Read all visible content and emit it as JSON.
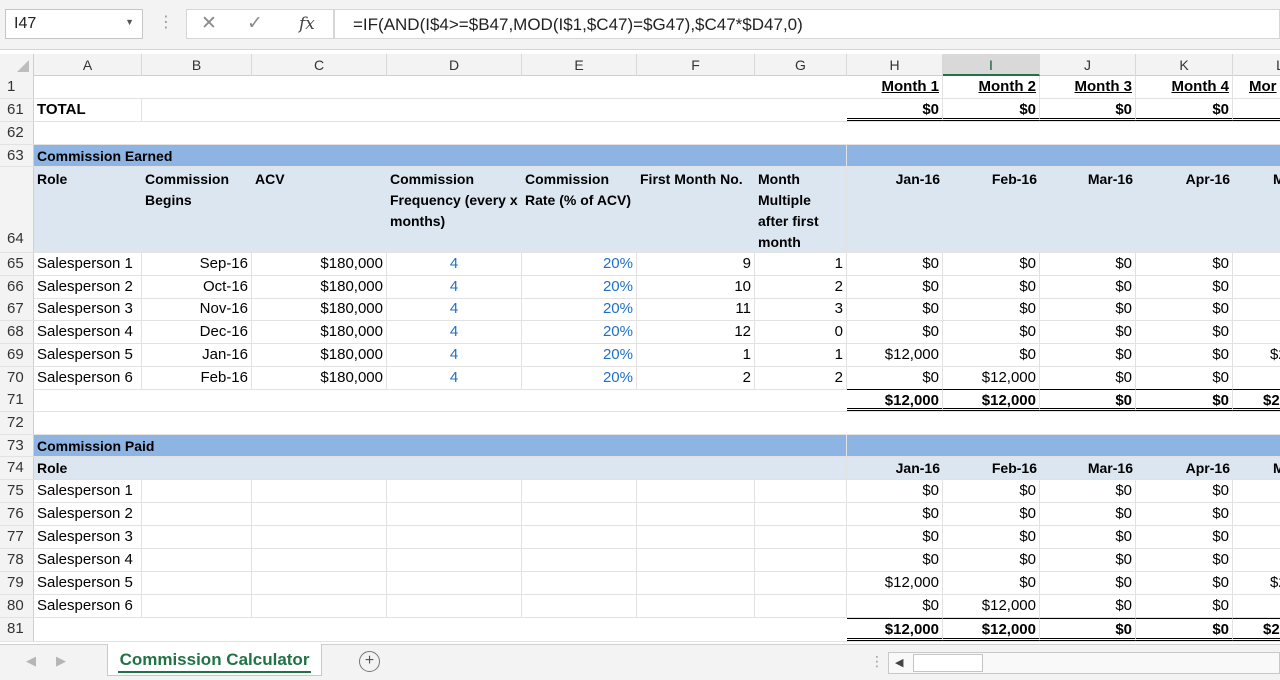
{
  "formula_bar": {
    "name_box": "I47",
    "formula": "=IF(AND(I$4>=$B47,MOD(I$1,$C47)=$G47),$C47*$D47,0)",
    "cancel_icon": "✕",
    "enter_icon": "✓",
    "fx_icon": "fx"
  },
  "columns": [
    "A",
    "B",
    "C",
    "D",
    "E",
    "F",
    "G",
    "H",
    "I",
    "J",
    "K",
    "L"
  ],
  "row_numbers": {
    "r1": "1",
    "r61": "61",
    "r62": "62",
    "r63": "63",
    "r64": "64",
    "r65": "65",
    "r66": "66",
    "r67": "67",
    "r68": "68",
    "r69": "69",
    "r70": "70",
    "r71": "71",
    "r72": "72",
    "r73": "73",
    "r74": "74",
    "r75": "75",
    "r76": "76",
    "r77": "77",
    "r78": "78",
    "r79": "79",
    "r80": "80",
    "r81": "81"
  },
  "month_headers": [
    "Month 1",
    "Month 2",
    "Month 3",
    "Month 4",
    "Mor"
  ],
  "total_row": {
    "label": "TOTAL",
    "values": [
      "$0",
      "$0",
      "$0",
      "$0"
    ]
  },
  "earned": {
    "title": "Commission Earned",
    "headers": {
      "role": "Role",
      "begins": "Commission Begins",
      "acv": "ACV",
      "freq": "Commission Frequency (every x months)",
      "rate": "Commission Rate (% of ACV)",
      "first_month": "First Month No.",
      "multiple": "Month Multiple after first month",
      "months": [
        "Jan-16",
        "Feb-16",
        "Mar-16",
        "Apr-16",
        "M"
      ]
    },
    "rows": [
      {
        "role": "Salesperson 1",
        "begins": "Sep-16",
        "acv": "$180,000",
        "freq": "4",
        "rate": "20%",
        "first": "9",
        "mult": "1",
        "m": [
          "$0",
          "$0",
          "$0",
          "$0",
          ""
        ]
      },
      {
        "role": "Salesperson 2",
        "begins": "Oct-16",
        "acv": "$180,000",
        "freq": "4",
        "rate": "20%",
        "first": "10",
        "mult": "2",
        "m": [
          "$0",
          "$0",
          "$0",
          "$0",
          ""
        ]
      },
      {
        "role": "Salesperson 3",
        "begins": "Nov-16",
        "acv": "$180,000",
        "freq": "4",
        "rate": "20%",
        "first": "11",
        "mult": "3",
        "m": [
          "$0",
          "$0",
          "$0",
          "$0",
          ""
        ]
      },
      {
        "role": "Salesperson 4",
        "begins": "Dec-16",
        "acv": "$180,000",
        "freq": "4",
        "rate": "20%",
        "first": "12",
        "mult": "0",
        "m": [
          "$0",
          "$0",
          "$0",
          "$0",
          ""
        ]
      },
      {
        "role": "Salesperson 5",
        "begins": "Jan-16",
        "acv": "$180,000",
        "freq": "4",
        "rate": "20%",
        "first": "1",
        "mult": "1",
        "m": [
          "$12,000",
          "$0",
          "$0",
          "$0",
          "$2"
        ]
      },
      {
        "role": "Salesperson 6",
        "begins": "Feb-16",
        "acv": "$180,000",
        "freq": "4",
        "rate": "20%",
        "first": "2",
        "mult": "2",
        "m": [
          "$0",
          "$12,000",
          "$0",
          "$0",
          ""
        ]
      }
    ],
    "totals": [
      "$12,000",
      "$12,000",
      "$0",
      "$0",
      "$2"
    ]
  },
  "paid": {
    "title": "Commission Paid",
    "role_header": "Role",
    "months": [
      "Jan-16",
      "Feb-16",
      "Mar-16",
      "Apr-16",
      "M"
    ],
    "rows": [
      {
        "role": "Salesperson 1",
        "m": [
          "$0",
          "$0",
          "$0",
          "$0",
          ""
        ]
      },
      {
        "role": "Salesperson 2",
        "m": [
          "$0",
          "$0",
          "$0",
          "$0",
          ""
        ]
      },
      {
        "role": "Salesperson 3",
        "m": [
          "$0",
          "$0",
          "$0",
          "$0",
          ""
        ]
      },
      {
        "role": "Salesperson 4",
        "m": [
          "$0",
          "$0",
          "$0",
          "$0",
          ""
        ]
      },
      {
        "role": "Salesperson 5",
        "m": [
          "$12,000",
          "$0",
          "$0",
          "$0",
          "$2"
        ]
      },
      {
        "role": "Salesperson 6",
        "m": [
          "$0",
          "$12,000",
          "$0",
          "$0",
          ""
        ]
      }
    ],
    "totals": [
      "$12,000",
      "$12,000",
      "$0",
      "$0",
      "$2"
    ]
  },
  "sheet_tabs": {
    "active": "Commission Calculator",
    "add_icon": "+"
  },
  "colors": {
    "band_dark": "#8db4e2",
    "band_light": "#dce6f1",
    "input_blue": "#1f6fc9",
    "excel_green": "#217346"
  }
}
